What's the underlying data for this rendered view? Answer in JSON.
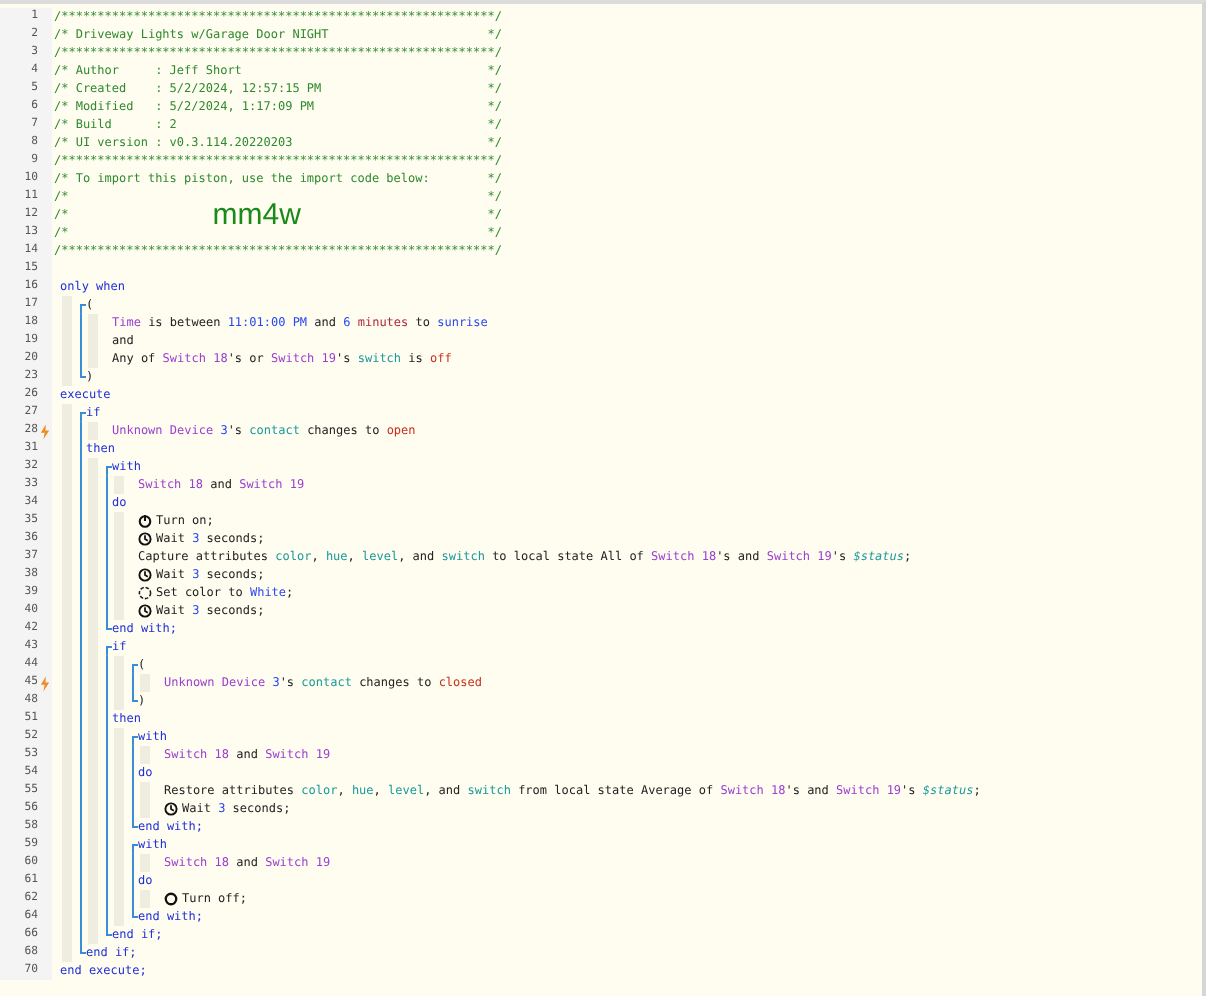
{
  "header": [
    {
      "n": "1",
      "text": "/************************************************************/"
    },
    {
      "n": "2",
      "text": "/* Driveway Lights w/Garage Door NIGHT",
      "end": "*/"
    },
    {
      "n": "3",
      "text": "/************************************************************/"
    },
    {
      "n": "4",
      "text": "/* Author     : Jeff Short",
      "end": "*/"
    },
    {
      "n": "5",
      "text": "/* Created    : 5/2/2024, 12:57:15 PM",
      "end": "*/"
    },
    {
      "n": "6",
      "text": "/* Modified   : 5/2/2024, 1:17:09 PM",
      "end": "*/"
    },
    {
      "n": "7",
      "text": "/* Build      : 2",
      "end": "*/"
    },
    {
      "n": "8",
      "text": "/* UI version : v0.3.114.20220203",
      "end": "*/"
    },
    {
      "n": "9",
      "text": "/************************************************************/"
    },
    {
      "n": "10",
      "text": "/* To import this piston, use the import code below:",
      "end": "*/"
    },
    {
      "n": "11",
      "text": "/*",
      "end": "*/"
    },
    {
      "n": "12",
      "text": "/*",
      "code": "mm4w",
      "end": "*/"
    },
    {
      "n": "13",
      "text": "/*",
      "end": "*/"
    },
    {
      "n": "14",
      "text": "/************************************************************/"
    },
    {
      "n": "15"
    }
  ],
  "body": [
    {
      "n": "16",
      "tokens": [
        {
          "kind": "kw",
          "text": "only when"
        }
      ],
      "children": [
        {
          "n": "17",
          "tokens": [
            {
              "kind": "txt",
              "text": "("
            }
          ],
          "children": [
            {
              "n": "18",
              "tokens": [
                {
                  "kind": "dev",
                  "text": "Time"
                },
                {
                  "kind": "txt",
                  "text": " is between "
                },
                {
                  "kind": "num",
                  "text": "11:01:00 PM"
                },
                {
                  "kind": "txt",
                  "text": " and "
                },
                {
                  "kind": "num",
                  "text": "6"
                },
                {
                  "kind": "unit",
                  "text": " minutes"
                },
                {
                  "kind": "txt",
                  "text": " to "
                },
                {
                  "kind": "num",
                  "text": "sunrise"
                }
              ]
            },
            {
              "n": "19",
              "tokens": [
                {
                  "kind": "txt",
                  "text": "and"
                }
              ]
            },
            {
              "n": "20",
              "tokens": [
                {
                  "kind": "txt",
                  "text": "Any of "
                },
                {
                  "kind": "dev",
                  "text": "Switch 18"
                },
                {
                  "kind": "txt",
                  "text": "'s or "
                },
                {
                  "kind": "dev",
                  "text": "Switch 19"
                },
                {
                  "kind": "txt",
                  "text": "'s "
                },
                {
                  "kind": "attr",
                  "text": "switch"
                },
                {
                  "kind": "txt",
                  "text": " is "
                },
                {
                  "kind": "val",
                  "text": "off"
                }
              ]
            }
          ],
          "close": {
            "n": "23",
            "tokens": [
              {
                "kind": "txt",
                "text": ")"
              }
            ]
          }
        }
      ]
    },
    {
      "n": "26",
      "tokens": [
        {
          "kind": "kw",
          "text": "execute"
        }
      ],
      "children": [
        {
          "n": "27",
          "tokens": [
            {
              "kind": "kw",
              "text": "if"
            }
          ],
          "children": [
            {
              "n": "28",
              "trigger": true,
              "tokens": [
                {
                  "kind": "dev",
                  "text": "Unknown Device "
                },
                {
                  "kind": "num",
                  "text": "3"
                },
                {
                  "kind": "txt",
                  "text": "'s "
                },
                {
                  "kind": "attr",
                  "text": "contact"
                },
                {
                  "kind": "txt",
                  "text": " changes to "
                },
                {
                  "kind": "val",
                  "text": "open"
                }
              ]
            }
          ],
          "more": [
            {
              "n": "31",
              "tokens": [
                {
                  "kind": "kw",
                  "text": "then"
                }
              ],
              "children": [
                {
                  "n": "32",
                  "tokens": [
                    {
                      "kind": "kw",
                      "text": "with"
                    }
                  ],
                  "children": [
                    {
                      "n": "33",
                      "tokens": [
                        {
                          "kind": "dev",
                          "text": "Switch 18"
                        },
                        {
                          "kind": "txt",
                          "text": " and "
                        },
                        {
                          "kind": "dev",
                          "text": "Switch 19"
                        }
                      ]
                    }
                  ],
                  "more": [
                    {
                      "n": "34",
                      "tokens": [
                        {
                          "kind": "kw",
                          "text": "do"
                        }
                      ],
                      "children": [
                        {
                          "n": "35",
                          "kind": "on",
                          "tokens": [
                            {
                              "kind": "txt",
                              "text": "Turn on;"
                            }
                          ]
                        },
                        {
                          "n": "36",
                          "kind": "wait",
                          "tokens": [
                            {
                              "kind": "txt",
                              "text": "Wait "
                            },
                            {
                              "kind": "num",
                              "text": "3"
                            },
                            {
                              "kind": "txt",
                              "text": " seconds;"
                            }
                          ]
                        },
                        {
                          "n": "37",
                          "tokens": [
                            {
                              "kind": "txt",
                              "text": "Capture attributes "
                            },
                            {
                              "kind": "attr",
                              "text": "color"
                            },
                            {
                              "kind": "txt",
                              "text": ", "
                            },
                            {
                              "kind": "attr",
                              "text": "hue"
                            },
                            {
                              "kind": "txt",
                              "text": ", "
                            },
                            {
                              "kind": "attr",
                              "text": "level"
                            },
                            {
                              "kind": "txt",
                              "text": ", and "
                            },
                            {
                              "kind": "attr",
                              "text": "switch"
                            },
                            {
                              "kind": "txt",
                              "text": " to local state All of "
                            },
                            {
                              "kind": "dev",
                              "text": "Switch 18"
                            },
                            {
                              "kind": "txt",
                              "text": "'s and "
                            },
                            {
                              "kind": "dev",
                              "text": "Switch 19"
                            },
                            {
                              "kind": "txt",
                              "text": "'s "
                            },
                            {
                              "kind": "var",
                              "text": "$status"
                            },
                            {
                              "kind": "txt",
                              "text": ";"
                            }
                          ]
                        },
                        {
                          "n": "38",
                          "kind": "wait",
                          "tokens": [
                            {
                              "kind": "txt",
                              "text": "Wait "
                            },
                            {
                              "kind": "num",
                              "text": "3"
                            },
                            {
                              "kind": "txt",
                              "text": " seconds;"
                            }
                          ]
                        },
                        {
                          "n": "39",
                          "kind": "color",
                          "tokens": [
                            {
                              "kind": "txt",
                              "text": "Set color to "
                            },
                            {
                              "kind": "num",
                              "text": "White"
                            },
                            {
                              "kind": "txt",
                              "text": ";"
                            }
                          ]
                        },
                        {
                          "n": "40",
                          "kind": "wait",
                          "tokens": [
                            {
                              "kind": "txt",
                              "text": "Wait "
                            },
                            {
                              "kind": "num",
                              "text": "3"
                            },
                            {
                              "kind": "txt",
                              "text": " seconds;"
                            }
                          ]
                        }
                      ]
                    }
                  ],
                  "close": {
                    "n": "42",
                    "tokens": [
                      {
                        "kind": "kw",
                        "text": "end with;"
                      }
                    ]
                  }
                },
                {
                  "n": "43",
                  "tokens": [
                    {
                      "kind": "kw",
                      "text": "if"
                    }
                  ],
                  "children": [
                    {
                      "n": "44",
                      "tokens": [
                        {
                          "kind": "txt",
                          "text": "("
                        }
                      ],
                      "children": [
                        {
                          "n": "45",
                          "trigger": true,
                          "tokens": [
                            {
                              "kind": "dev",
                              "text": "Unknown Device "
                            },
                            {
                              "kind": "num",
                              "text": "3"
                            },
                            {
                              "kind": "txt",
                              "text": "'s "
                            },
                            {
                              "kind": "attr",
                              "text": "contact"
                            },
                            {
                              "kind": "txt",
                              "text": " changes to "
                            },
                            {
                              "kind": "val",
                              "text": "closed"
                            }
                          ]
                        }
                      ],
                      "close": {
                        "n": "48",
                        "tokens": [
                          {
                            "kind": "txt",
                            "text": ")"
                          }
                        ]
                      }
                    }
                  ],
                  "more": [
                    {
                      "n": "51",
                      "tokens": [
                        {
                          "kind": "kw",
                          "text": "then"
                        }
                      ],
                      "children": [
                        {
                          "n": "52",
                          "tokens": [
                            {
                              "kind": "kw",
                              "text": "with"
                            }
                          ],
                          "children": [
                            {
                              "n": "53",
                              "tokens": [
                                {
                                  "kind": "dev",
                                  "text": "Switch 18"
                                },
                                {
                                  "kind": "txt",
                                  "text": " and "
                                },
                                {
                                  "kind": "dev",
                                  "text": "Switch 19"
                                }
                              ]
                            }
                          ],
                          "more": [
                            {
                              "n": "54",
                              "tokens": [
                                {
                                  "kind": "kw",
                                  "text": "do"
                                }
                              ],
                              "children": [
                                {
                                  "n": "55",
                                  "tokens": [
                                    {
                                      "kind": "txt",
                                      "text": "Restore attributes "
                                    },
                                    {
                                      "kind": "attr",
                                      "text": "color"
                                    },
                                    {
                                      "kind": "txt",
                                      "text": ", "
                                    },
                                    {
                                      "kind": "attr",
                                      "text": "hue"
                                    },
                                    {
                                      "kind": "txt",
                                      "text": ", "
                                    },
                                    {
                                      "kind": "attr",
                                      "text": "level"
                                    },
                                    {
                                      "kind": "txt",
                                      "text": ", and "
                                    },
                                    {
                                      "kind": "attr",
                                      "text": "switch"
                                    },
                                    {
                                      "kind": "txt",
                                      "text": " from local state Average of "
                                    },
                                    {
                                      "kind": "dev",
                                      "text": "Switch 18"
                                    },
                                    {
                                      "kind": "txt",
                                      "text": "'s and "
                                    },
                                    {
                                      "kind": "dev",
                                      "text": "Switch 19"
                                    },
                                    {
                                      "kind": "txt",
                                      "text": "'s "
                                    },
                                    {
                                      "kind": "var",
                                      "text": "$status"
                                    },
                                    {
                                      "kind": "txt",
                                      "text": ";"
                                    }
                                  ]
                                },
                                {
                                  "n": "56",
                                  "kind": "wait",
                                  "tokens": [
                                    {
                                      "kind": "txt",
                                      "text": "Wait "
                                    },
                                    {
                                      "kind": "num",
                                      "text": "3"
                                    },
                                    {
                                      "kind": "txt",
                                      "text": " seconds;"
                                    }
                                  ]
                                }
                              ]
                            }
                          ],
                          "close": {
                            "n": "58",
                            "tokens": [
                              {
                                "kind": "kw",
                                "text": "end with;"
                              }
                            ]
                          }
                        },
                        {
                          "n": "59",
                          "tokens": [
                            {
                              "kind": "kw",
                              "text": "with"
                            }
                          ],
                          "children": [
                            {
                              "n": "60",
                              "tokens": [
                                {
                                  "kind": "dev",
                                  "text": "Switch 18"
                                },
                                {
                                  "kind": "txt",
                                  "text": " and "
                                },
                                {
                                  "kind": "dev",
                                  "text": "Switch 19"
                                }
                              ]
                            }
                          ],
                          "more": [
                            {
                              "n": "61",
                              "tokens": [
                                {
                                  "kind": "kw",
                                  "text": "do"
                                }
                              ],
                              "children": [
                                {
                                  "n": "62",
                                  "kind": "off",
                                  "tokens": [
                                    {
                                      "kind": "txt",
                                      "text": "Turn off;"
                                    }
                                  ]
                                }
                              ]
                            }
                          ],
                          "close": {
                            "n": "64",
                            "tokens": [
                              {
                                "kind": "kw",
                                "text": "end with;"
                              }
                            ]
                          }
                        }
                      ]
                    }
                  ],
                  "close": {
                    "n": "66",
                    "tokens": [
                      {
                        "kind": "kw",
                        "text": "end if;"
                      }
                    ]
                  }
                }
              ]
            }
          ],
          "close": {
            "n": "68",
            "tokens": [
              {
                "kind": "kw",
                "text": "end if;"
              }
            ]
          }
        }
      ],
      "close": {
        "n": "70",
        "tokens": [
          {
            "kind": "kw",
            "text": "end execute;"
          }
        ]
      }
    }
  ]
}
